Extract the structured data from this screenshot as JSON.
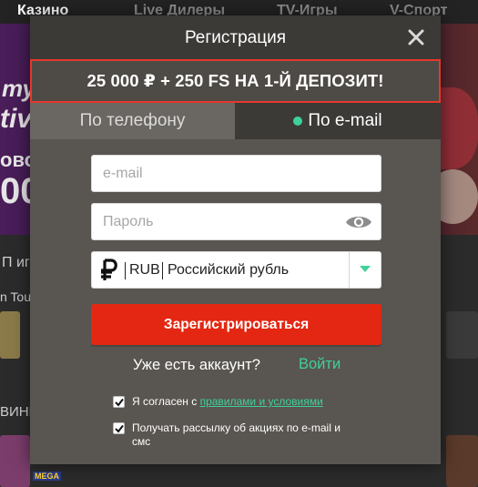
{
  "background": {
    "nav": [
      "Казино",
      "Live Дилеры",
      "TV-Игры",
      "V-Спорт"
    ],
    "hero_fragments": [
      "ту",
      "tiv",
      "ово",
      "00"
    ],
    "row_fragments": [
      "П иг",
      "n Tou",
      "ВИНК",
      "MEGA"
    ]
  },
  "modal": {
    "title": "Регистрация",
    "close_icon": "close-icon",
    "promo": "25 000 ₽ + 250 FS НА 1-Й ДЕПОЗИТ!",
    "tabs": [
      {
        "label": "По телефону",
        "active": false
      },
      {
        "label": "По e-mail",
        "active": true
      }
    ],
    "email_placeholder": "e-mail",
    "password_placeholder": "Пароль",
    "password_icon": "eye-icon",
    "currency": {
      "symbol_icon": "ruble-icon",
      "code": "RUB",
      "name": "Российский рубль",
      "dropdown_icon": "chevron-down-icon"
    },
    "register_label": "Зарегистрироваться",
    "account_question": "Уже есть аккаунт?",
    "login_label": "Войти",
    "agree_prefix": "Я согласен с ",
    "agree_link": "правилами и условиями",
    "newsletter_label": "Получать рассылку об акциях по e-mail и смс",
    "checkboxes": {
      "agree_checked": true,
      "newsletter_checked": true
    }
  },
  "colors": {
    "accent": "#3fd19a",
    "primary_button": "#e32712",
    "promo_border": "#e5382b",
    "modal_bg": "#595550",
    "header_bg": "#3c3a37"
  }
}
